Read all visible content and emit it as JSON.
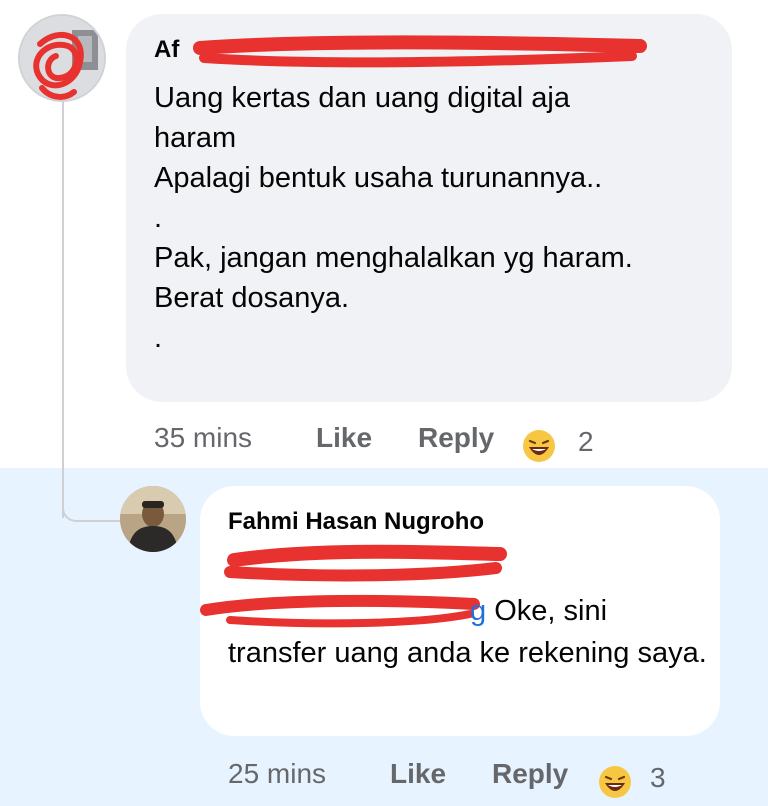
{
  "comment1": {
    "author_visible": "Af",
    "lines": [
      "Uang kertas dan uang digital aja",
      "haram",
      "Apalagi bentuk usaha turunannya..",
      ".",
      "Pak, jangan menghalalkan yg haram.",
      "Berat dosanya.",
      "."
    ],
    "time": "35 mins",
    "like_label": "Like",
    "reply_label": "Reply",
    "reaction_icon": "laughing-emoji-icon",
    "reaction_count": "2"
  },
  "comment2": {
    "author": "Fahmi Hasan Nugroho",
    "mention_visible_end": "g",
    "text_inline": " Oke, sini",
    "text_rest": "transfer uang anda ke rekening saya.",
    "time": "25 mins",
    "like_label": "Like",
    "reply_label": "Reply",
    "reaction_icon": "laughing-emoji-icon",
    "reaction_count": "3"
  },
  "colors": {
    "highlight_bg": "#e7f3ff",
    "bubble_bg": "#f0f2f5",
    "meta_text": "#65676b",
    "mention": "#216fdb",
    "redaction": "#e8322f"
  }
}
